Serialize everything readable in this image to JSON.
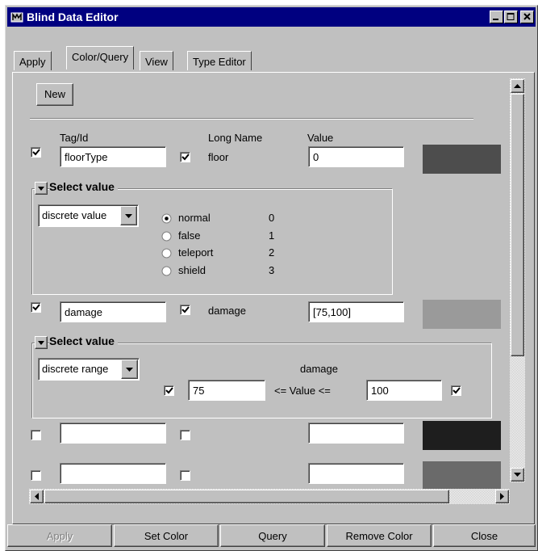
{
  "window": {
    "title": "Blind Data Editor",
    "controls": [
      "minimize-icon",
      "maximize-icon",
      "close-icon"
    ]
  },
  "tabs": [
    {
      "label": "Apply",
      "active": false
    },
    {
      "label": "Color/Query",
      "active": true
    },
    {
      "label": "View",
      "active": false
    },
    {
      "label": "Type Editor",
      "active": false
    }
  ],
  "toolbar": {
    "new_label": "New"
  },
  "headers": {
    "tag_id": "Tag/Id",
    "long_name": "Long Name",
    "value": "Value"
  },
  "rows": [
    {
      "checked": true,
      "tag": "floorType",
      "long_checked": true,
      "long_name": "floor",
      "value": "0",
      "color": "#4d4d4d"
    },
    {
      "checked": true,
      "tag": "damage",
      "long_checked": true,
      "long_name": "damage",
      "value": "[75,100]",
      "color": "#9a9a9a"
    },
    {
      "checked": false,
      "tag": "",
      "long_checked": false,
      "long_name": "",
      "value": "",
      "color": "#1e1e1e"
    },
    {
      "checked": false,
      "tag": "",
      "long_checked": false,
      "long_name": "",
      "value": "",
      "color": "#6a6a6a"
    }
  ],
  "select_value_1": {
    "title": "Select value",
    "mode": "discrete value",
    "options": [
      {
        "label": "normal",
        "value": "0",
        "selected": true
      },
      {
        "label": "false",
        "value": "1",
        "selected": false
      },
      {
        "label": "teleport",
        "value": "2",
        "selected": false
      },
      {
        "label": "shield",
        "value": "3",
        "selected": false
      }
    ]
  },
  "select_value_2": {
    "title": "Select value",
    "mode": "discrete range",
    "caption": "damage",
    "min_checked": true,
    "min": "75",
    "relation": "<= Value <=",
    "max": "100",
    "max_checked": true
  },
  "buttons": {
    "apply": "Apply",
    "set_color": "Set Color",
    "query": "Query",
    "remove_color": "Remove Color",
    "close": "Close"
  }
}
